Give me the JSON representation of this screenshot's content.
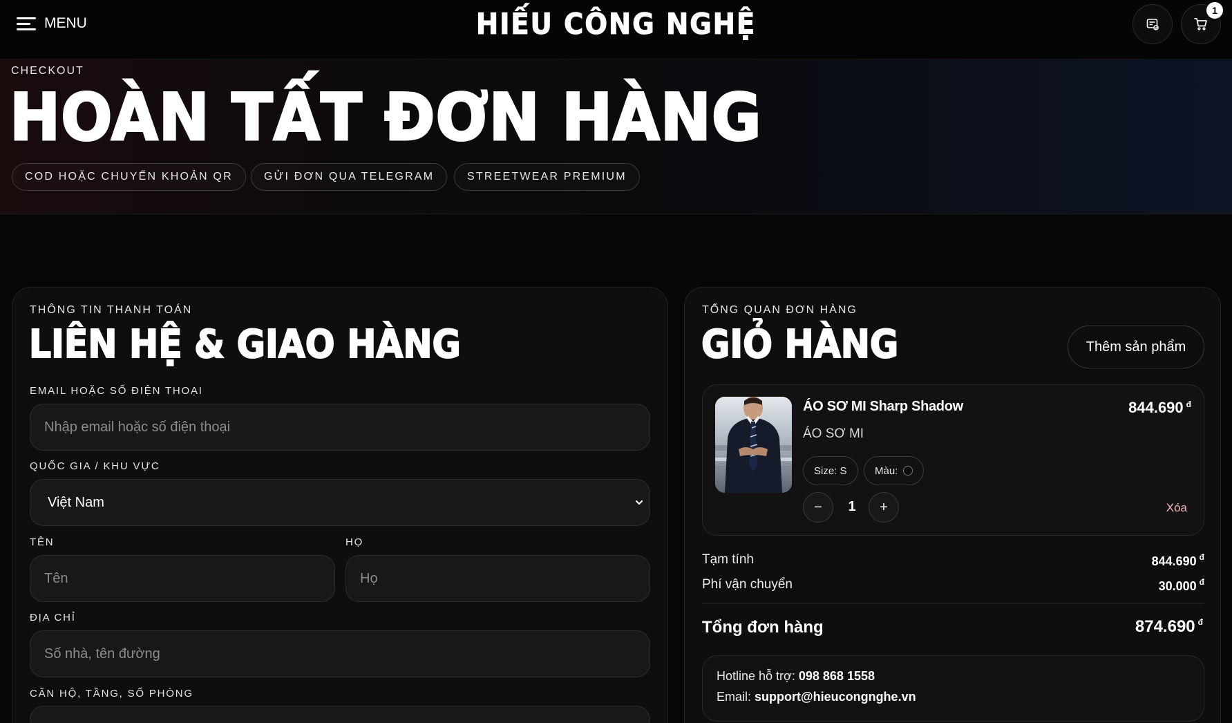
{
  "header": {
    "menu_label": "MENU",
    "brand": "HIẾU CÔNG NGHỆ",
    "cart_count": "1"
  },
  "hero": {
    "eyebrow": "CHECKOUT",
    "title": "HOÀN TẤT ĐƠN HÀNG",
    "chips": [
      "COD HOẶC CHUYỂN KHOẢN QR",
      "GỬI ĐƠN QUA TELEGRAM",
      "STREETWEAR PREMIUM"
    ]
  },
  "billing": {
    "eyebrow": "THÔNG TIN THANH TOÁN",
    "title": "LIÊN HỆ & GIAO HÀNG",
    "contact_label": "EMAIL HOẶC SỐ ĐIỆN THOẠI",
    "contact_placeholder": "Nhập email hoặc số điện thoại",
    "country_label": "QUỐC GIA / KHU VỰC",
    "country_value": "Việt Nam",
    "first_name_label": "TÊN",
    "first_name_placeholder": "Tên",
    "last_name_label": "HỌ",
    "last_name_placeholder": "Họ",
    "address_label": "ĐỊA CHỈ",
    "address_placeholder": "Số nhà, tên đường",
    "apartment_label": "CĂN HỘ, TẦNG, SỐ PHÒNG"
  },
  "cart": {
    "eyebrow": "TỔNG QUAN ĐƠN HÀNG",
    "title": "GIỎ HÀNG",
    "add_button": "Thêm sản phẩm",
    "item": {
      "name": "ÁO SƠ MI Sharp Shadow",
      "category": "ÁO SƠ MI",
      "price": "844.690",
      "currency": "đ",
      "size": "Size: S",
      "color_label": "Màu:",
      "color_value": "#0a0a0a",
      "quantity": "1",
      "minus": "−",
      "plus": "+",
      "remove": "Xóa"
    },
    "subtotal_label": "Tạm tính",
    "subtotal": "844.690",
    "shipping_label": "Phí vận chuyển",
    "shipping": "30.000",
    "total_label": "Tổng đơn hàng",
    "total": "874.690",
    "currency": "đ"
  },
  "support": {
    "hotline_label": "Hotline hỗ trợ:",
    "hotline": "098 868 1558",
    "email_label": "Email:",
    "email": "support@hieucongnghe.vn"
  }
}
